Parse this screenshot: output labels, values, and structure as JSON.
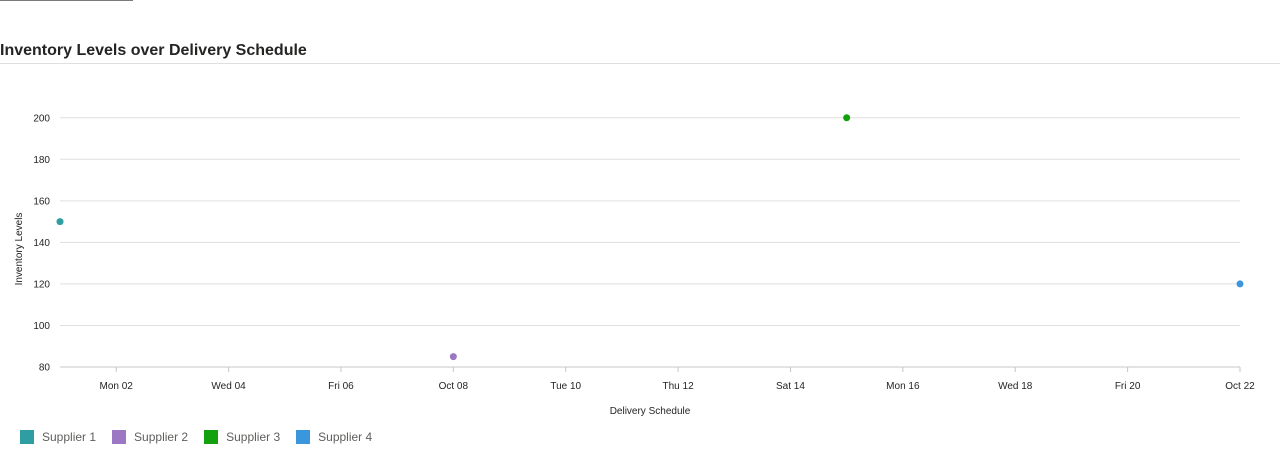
{
  "chart_data": {
    "type": "scatter",
    "title": "Inventory Levels over Delivery Schedule",
    "xlabel": "Delivery Schedule",
    "ylabel": "Inventory Levels",
    "x_tick_labels": [
      "Mon 02",
      "Wed 04",
      "Fri 06",
      "Oct 08",
      "Tue 10",
      "Thu 12",
      "Sat 14",
      "Mon 16",
      "Wed 18",
      "Fri 20",
      "Oct 22"
    ],
    "x_ticks": [
      "2023-10-02",
      "2023-10-04",
      "2023-10-06",
      "2023-10-08",
      "2023-10-10",
      "2023-10-12",
      "2023-10-14",
      "2023-10-16",
      "2023-10-18",
      "2023-10-20",
      "2023-10-22"
    ],
    "xlim": [
      "2023-10-01",
      "2023-10-22"
    ],
    "y_ticks": [
      80,
      100,
      120,
      140,
      160,
      180,
      200
    ],
    "ylim": [
      80,
      210
    ],
    "grid": true,
    "legend_position": "bottom-left",
    "series": [
      {
        "name": "Supplier 1",
        "color": "#2f9ea3",
        "points": [
          {
            "x": "2023-10-01",
            "y": 150
          }
        ]
      },
      {
        "name": "Supplier 2",
        "color": "#9c77c4",
        "points": [
          {
            "x": "2023-10-08",
            "y": 85
          }
        ]
      },
      {
        "name": "Supplier 3",
        "color": "#13a10e",
        "points": [
          {
            "x": "2023-10-15",
            "y": 200
          }
        ]
      },
      {
        "name": "Supplier 4",
        "color": "#3a96dd",
        "points": [
          {
            "x": "2023-10-22",
            "y": 120
          }
        ]
      }
    ]
  }
}
